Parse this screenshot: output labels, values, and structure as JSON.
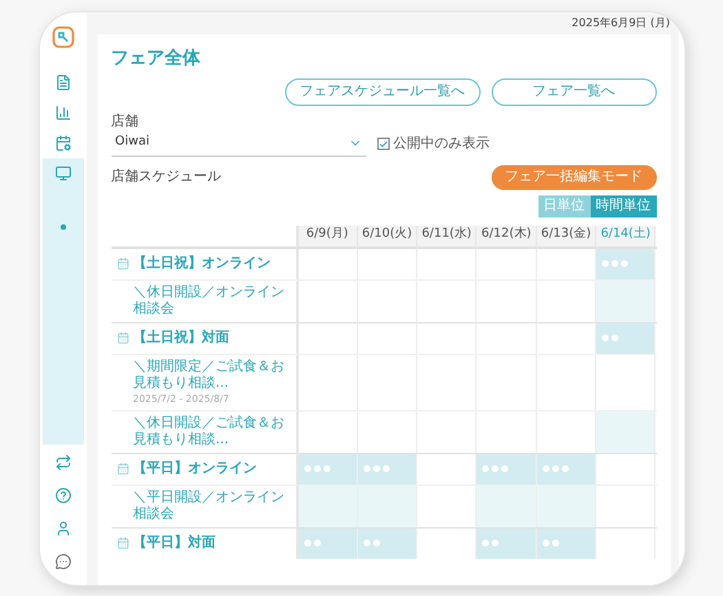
{
  "header": {
    "date": "2025年6月9日 (月)"
  },
  "sidebar": {
    "items": [
      {
        "selected": false
      },
      {
        "selected": false
      },
      {
        "selected": false
      },
      {
        "selected": true
      }
    ],
    "bottom_items": [
      {
        "selected": false
      },
      {
        "selected": false
      },
      {
        "selected": false
      },
      {
        "selected": false
      }
    ]
  },
  "page": {
    "title": "フェア全体",
    "buttons": [
      "フェアスケジュール一覧へ",
      "フェア一覧へ"
    ]
  },
  "store": {
    "label": "店舗",
    "value": "Oiwai",
    "checkbox": {
      "label": "公開中のみ表示",
      "checked": true
    }
  },
  "schedule": {
    "label": "店舗スケジュール",
    "edit_button": "フェア一括編集モード",
    "units": [
      {
        "label": "日単位",
        "selected": false
      },
      {
        "label": "時間単位",
        "selected": true
      }
    ],
    "columns": [
      {
        "label": "6/9(月)",
        "highlighted": false
      },
      {
        "label": "6/10(火)",
        "highlighted": false
      },
      {
        "label": "6/11(水)",
        "highlighted": false
      },
      {
        "label": "6/12(木)",
        "highlighted": false
      },
      {
        "label": "6/13(金)",
        "highlighted": false
      },
      {
        "label": "6/14(土)",
        "highlighted": true
      }
    ],
    "rows": [
      {
        "kind": "group",
        "name": "【土日祝】オンライン",
        "cells": [
          {
            "kind": "empty"
          },
          {
            "kind": "empty"
          },
          {
            "kind": "empty"
          },
          {
            "kind": "empty"
          },
          {
            "kind": "empty"
          },
          {
            "kind": "open",
            "slots": [
              {
                "open": true
              },
              {
                "open": true
              },
              {
                "open": true
              }
            ]
          }
        ]
      },
      {
        "kind": "fair",
        "name": "＼休日開設／オンライン相談会",
        "cells": [
          {
            "kind": "empty"
          },
          {
            "kind": "empty"
          },
          {
            "kind": "empty"
          },
          {
            "kind": "empty"
          },
          {
            "kind": "empty"
          },
          {
            "kind": "sub"
          }
        ]
      },
      {
        "kind": "group",
        "name": "【土日祝】対面",
        "cells": [
          {
            "kind": "empty"
          },
          {
            "kind": "empty"
          },
          {
            "kind": "empty"
          },
          {
            "kind": "empty"
          },
          {
            "kind": "empty"
          },
          {
            "kind": "open",
            "slots": [
              {
                "open": true
              },
              {
                "open": true
              }
            ]
          }
        ]
      },
      {
        "kind": "fair",
        "name": "＼期間限定／ご試食＆お見積もり相談...",
        "period": "2025/7/2 - 2025/8/7",
        "cells": [
          {
            "kind": "empty"
          },
          {
            "kind": "empty"
          },
          {
            "kind": "empty"
          },
          {
            "kind": "empty"
          },
          {
            "kind": "empty"
          },
          {
            "kind": "empty"
          }
        ]
      },
      {
        "kind": "fair",
        "name": "＼休日開設／ご試食＆お見積もり相談...",
        "cells": [
          {
            "kind": "empty"
          },
          {
            "kind": "empty"
          },
          {
            "kind": "empty"
          },
          {
            "kind": "empty"
          },
          {
            "kind": "empty"
          },
          {
            "kind": "sub"
          }
        ]
      },
      {
        "kind": "group",
        "name": "【平日】オンライン",
        "cells": [
          {
            "kind": "open",
            "slots": [
              {
                "open": true
              },
              {
                "open": true
              },
              {
                "open": true
              }
            ]
          },
          {
            "kind": "open",
            "slots": [
              {
                "open": true
              },
              {
                "open": true
              },
              {
                "open": true
              }
            ]
          },
          {
            "kind": "empty"
          },
          {
            "kind": "open",
            "slots": [
              {
                "open": true
              },
              {
                "open": true
              },
              {
                "open": true
              }
            ]
          },
          {
            "kind": "open",
            "slots": [
              {
                "open": true
              },
              {
                "open": true
              },
              {
                "open": true
              }
            ]
          },
          {
            "kind": "empty"
          }
        ]
      },
      {
        "kind": "fair",
        "name": "＼平日開設／オンライン相談会",
        "cells": [
          {
            "kind": "sub"
          },
          {
            "kind": "sub"
          },
          {
            "kind": "empty"
          },
          {
            "kind": "sub"
          },
          {
            "kind": "sub"
          },
          {
            "kind": "empty"
          }
        ]
      },
      {
        "kind": "group",
        "name": "【平日】対面",
        "cells": [
          {
            "kind": "open",
            "slots": [
              {
                "open": true
              },
              {
                "open": true
              }
            ]
          },
          {
            "kind": "open",
            "slots": [
              {
                "open": true
              },
              {
                "open": true
              }
            ]
          },
          {
            "kind": "empty"
          },
          {
            "kind": "open",
            "slots": [
              {
                "open": true
              },
              {
                "open": true
              }
            ]
          },
          {
            "kind": "open",
            "slots": [
              {
                "open": true
              },
              {
                "open": true
              }
            ]
          },
          {
            "kind": "empty"
          }
        ]
      }
    ]
  }
}
